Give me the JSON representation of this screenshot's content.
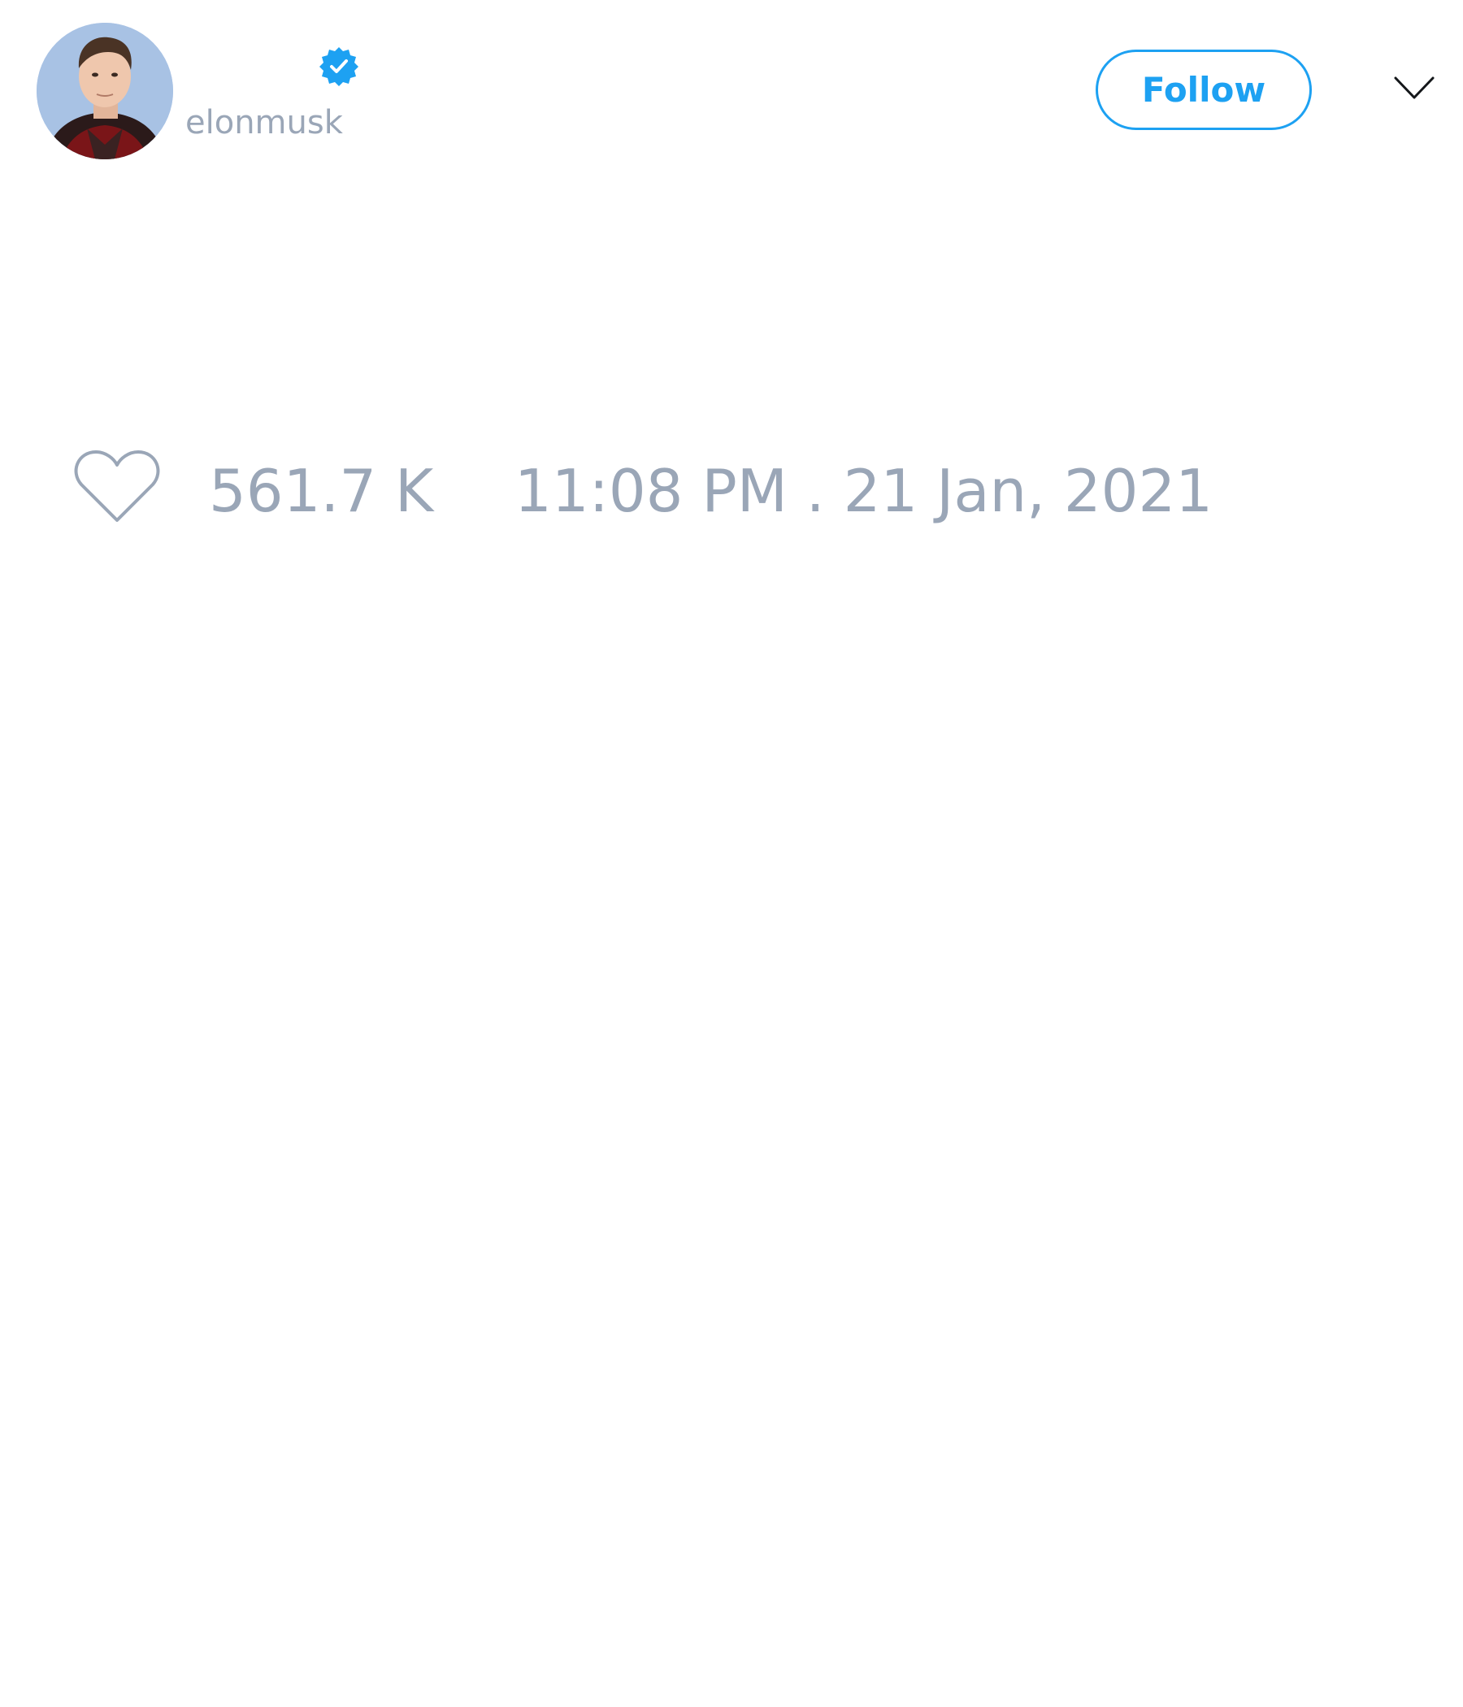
{
  "tweet": {
    "author": {
      "display_name": "",
      "handle": "elonmusk",
      "verified": true
    },
    "follow_label": "Follow",
    "likes": "561.7 K",
    "timestamp": "11:08 PM . 21 Jan, 2021"
  },
  "colors": {
    "accent": "#1da1f2",
    "muted_text": "#9aa6b7",
    "background": "#ffffff"
  },
  "icons": {
    "verified": "verified-badge-icon",
    "menu": "chevron-down-icon",
    "like": "heart-icon"
  }
}
